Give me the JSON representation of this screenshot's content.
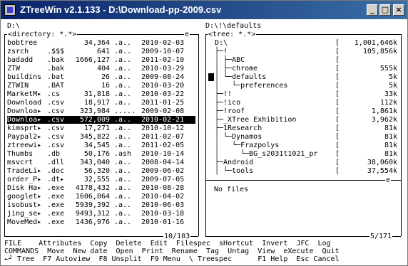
{
  "window": {
    "title": "ZTreeWin v2.1.133 - D:\\Download-pp-2009.csv",
    "buttons": {
      "minimize": "_",
      "maximize": "□",
      "close": "×"
    }
  },
  "path_line": "D:\\",
  "left": {
    "header": "<directory: *.*>",
    "header_tag": "e",
    "files": [
      {
        "name": "bobtree",
        "ext": "",
        "size": "34,364",
        "attr": ".a..",
        "date": "2010-02-03"
      },
      {
        "name": "zsrch",
        "ext": ".$$$",
        "size": "641",
        "attr": ".a..",
        "date": "2009-10-07"
      },
      {
        "name": "badadd",
        "ext": ".bak",
        "size": "1666,127",
        "attr": ".a..",
        "date": "2011-02-10"
      },
      {
        "name": "ZTW",
        "ext": ".bak",
        "size": "404",
        "attr": ".a..",
        "date": "2010-03-29"
      },
      {
        "name": "buildins",
        "ext": ".bat",
        "size": "26",
        "attr": ".a..",
        "date": "2009-08-24"
      },
      {
        "name": "ZTWIN",
        "ext": ".BAT",
        "size": "16",
        "attr": ".a..",
        "date": "2010-03-20"
      },
      {
        "name": "MarketM▸",
        "ext": ".cs",
        "size": "31,818",
        "attr": ".a..",
        "date": "2010-03-22"
      },
      {
        "name": "Download",
        "ext": ".csv",
        "size": "18,917",
        "attr": ".a..",
        "date": "2011-01-25"
      },
      {
        "name": "Downloa▸",
        "ext": ".csv",
        "size": "323,984",
        "attr": ".....",
        "date": "2009-02-08"
      },
      {
        "name": "Downloa▸",
        "ext": ".csv",
        "size": "572,009",
        "attr": ".a..",
        "date": "2010-02-21",
        "selected": true
      },
      {
        "name": "kimsprt▸",
        "ext": ".csv",
        "size": "17,271",
        "attr": ".a..",
        "date": "2010-10-12"
      },
      {
        "name": "Paypal2▸",
        "ext": ".csv",
        "size": "345,822",
        "attr": ".a..",
        "date": "2011-02-07"
      },
      {
        "name": "ztreewi▸",
        "ext": ".csv",
        "size": "34,545",
        "attr": ".a..",
        "date": "2011-02-05"
      },
      {
        "name": "Thumbs",
        "ext": ".db",
        "size": "50,176",
        "attr": ".ash",
        "date": "2010-10-14"
      },
      {
        "name": "msvcrt",
        "ext": ".dll",
        "size": "343,040",
        "attr": ".a..",
        "date": "2008-04-14"
      },
      {
        "name": "TradeLi▸",
        "ext": ".doc",
        "size": "56,320",
        "attr": ".a..",
        "date": "2009-06-02"
      },
      {
        "name": "order_P▸",
        "ext": ".dt▸",
        "size": "32,555",
        "attr": ".a..",
        "date": "2009-07-05"
      },
      {
        "name": "Disk Ha▸",
        "ext": ".exe",
        "size": "4178,432",
        "attr": ".a..",
        "date": "2010-08-28"
      },
      {
        "name": "googlet▸",
        "ext": ".exe",
        "size": "1606,064",
        "attr": ".a..",
        "date": "2010-04-02"
      },
      {
        "name": "isobust▸",
        "ext": ".exe",
        "size": "5939,392",
        "attr": ".a..",
        "date": "2010-06-03"
      },
      {
        "name": "jing_se▸",
        "ext": ".exe",
        "size": "9493,312",
        "attr": ".a..",
        "date": "2010-03-18"
      },
      {
        "name": "MoveMed▸",
        "ext": ".exe",
        "size": "1436,976",
        "attr": ".a..",
        "date": "2010-01-16"
      }
    ],
    "footer": "10/103"
  },
  "right": {
    "path": "D:\\!\\defaults",
    "header": "<tree: *.*>",
    "tree": [
      {
        "label": "D:\\",
        "size": "1,001,646k"
      },
      {
        "label": "├─!",
        "size": "105,856k"
      },
      {
        "label": "│ ├─ABC",
        "size": ""
      },
      {
        "label": "│ ├─chrome",
        "size": "555k"
      },
      {
        "label": "│ └─defaults",
        "size": "5k"
      },
      {
        "label": "│   └─preferences",
        "size": "5k"
      },
      {
        "label": "├─!!",
        "size": "33k"
      },
      {
        "label": "├─!ico",
        "size": "112k"
      },
      {
        "label": "├─!roof",
        "size": "1,861k"
      },
      {
        "label": "├─_XTree Exhibition",
        "size": "3,962k"
      },
      {
        "label": "├─1Research",
        "size": "81k"
      },
      {
        "label": "│ └─Dynamos",
        "size": "81k"
      },
      {
        "label": "│   └─Frazpolys",
        "size": "81k"
      },
      {
        "label": "│     └─BG_s2031t1021_pr",
        "size": "81k"
      },
      {
        "label": "├─Android",
        "size": "38,060k"
      },
      {
        "label": "│ └─tools",
        "size": "37,554k"
      }
    ],
    "lower_tag": "e",
    "info": "No files",
    "footer": "5/171"
  },
  "menu": {
    "line1": "FILE    Attributes  Copy  Delete  Edit  Filespec  sHortcut  Invert  JFC  Log",
    "line2": "COMMANDS  Move  New date  Open  Print  Rename  Tag  Untag  View  eXecute  Quit",
    "line3": "←┘ Tree  F7 Autoview  F8 Unsplit  F9 Menu  \\ Treespec      F1 Help  Esc Cancel"
  },
  "colors": {
    "titlebar": "#0a246a",
    "titlebar_end": "#3a6ea5",
    "highlight": "#000000"
  }
}
